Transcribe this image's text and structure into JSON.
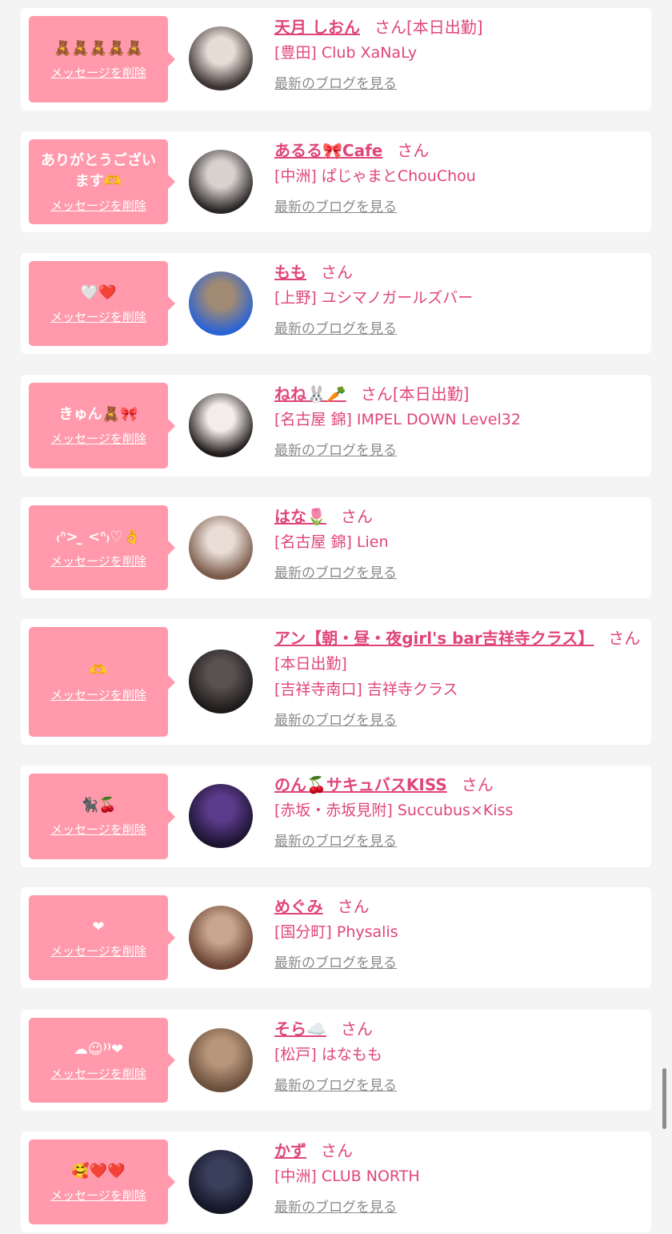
{
  "delete_label": "メッセージを削除",
  "blog_label": "最新のブログを見る",
  "san_label": "さん",
  "colors": {
    "page_bg": "#f4f4f4",
    "card_bg": "#ffffff",
    "bubble_bg": "#ff99ab",
    "accent_pink": "#e0457a",
    "link_gray": "#8a8a8a"
  },
  "items": [
    {
      "message": "🧸🧸🧸🧸🧸",
      "name": "天月 しおん",
      "status": "[本日出勤]",
      "shop": "[豊田] Club XaNaLy",
      "avatar_colors": [
        "#e8dcd6",
        "#3b3331"
      ]
    },
    {
      "message": "ありがとうございます🫶",
      "name": "あるる🎀Cafe",
      "status": "",
      "shop": "[中洲] ぱじゃまとChouChou",
      "avatar_colors": [
        "#d8d2cf",
        "#2a2626"
      ]
    },
    {
      "message": "🤍❤️",
      "name": "もも",
      "status": "",
      "shop": "[上野] ユシマノガールズバー",
      "avatar_colors": [
        "#a08a74",
        "#2a63d6"
      ]
    },
    {
      "message": "きゅん🧸🎀",
      "name": "ねね🐰🥕",
      "status": "[本日出勤]",
      "shop": "[名古屋 錦] IMPEL DOWN Level32",
      "avatar_colors": [
        "#f2ecea",
        "#221c1c"
      ]
    },
    {
      "message": "₍ᐢ> ̫ <ᐢ₎♡👌",
      "name": "はな🌷",
      "status": "",
      "shop": "[名古屋 錦] Lien",
      "avatar_colors": [
        "#e9ddd6",
        "#7a5a4a"
      ]
    },
    {
      "message": "🫶",
      "name": "アン【朝・昼・夜girl's bar吉祥寺クラス】",
      "status": "[本日出勤]",
      "shop": "[吉祥寺南口] 吉祥寺クラス",
      "avatar_colors": [
        "#5a5252",
        "#1e1a1a"
      ]
    },
    {
      "message": "🐈‍⬛🍒",
      "name": "のん🍒サキュバスKISS",
      "status": "",
      "shop": "[赤坂・赤坂見附] Succubus×Kiss",
      "avatar_colors": [
        "#5a3a8a",
        "#1c1430"
      ]
    },
    {
      "message": "❤",
      "name": "めぐみ",
      "status": "",
      "shop": "[国分町] Physalis",
      "avatar_colors": [
        "#c8a58c",
        "#6b4434"
      ]
    },
    {
      "message": "☁︎☺︎⁾⁾❤︎",
      "name": "そら☁️",
      "status": "",
      "shop": "[松戸] はなもも",
      "avatar_colors": [
        "#b8967a",
        "#6a4f3c"
      ]
    },
    {
      "message": "🥰❤️❤️",
      "name": "かず",
      "status": "",
      "shop": "[中洲] CLUB NORTH",
      "avatar_colors": [
        "#3a3f5c",
        "#141626"
      ]
    }
  ]
}
